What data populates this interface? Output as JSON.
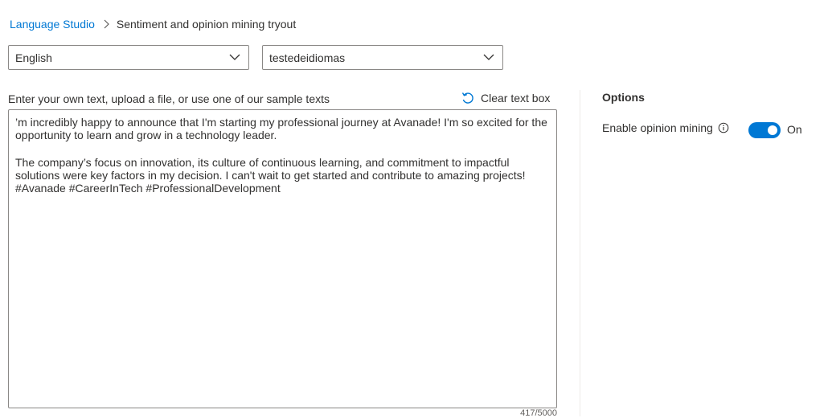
{
  "breadcrumb": {
    "root": "Language Studio",
    "current": "Sentiment and opinion mining tryout"
  },
  "selectors": {
    "language": "English",
    "project": "testedeidiomas"
  },
  "input": {
    "instructions": "Enter your own text, upload a file, or use one of our sample texts",
    "clear_label": "Clear text box",
    "paragraph_1": "’m incredibly happy to announce that I'm starting my professional journey at Avanade! I'm so excited for the opportunity to learn and grow in a technology leader.",
    "paragraph_2": "The company’s focus on innovation, its culture of continuous learning, and commitment to impactful solutions were key factors in my decision. I can't wait to get started and contribute to amazing projects!\n#Avanade #CareerInTech #ProfessionalDevelopment",
    "char_count": "417/5000"
  },
  "options": {
    "title": "Options",
    "opinion_mining_label": "Enable opinion mining",
    "opinion_mining_state": "On"
  },
  "icons": {
    "breadcrumb_separator": "chevron-right-icon",
    "dropdown": "chevron-down-icon",
    "clear": "undo-icon",
    "info": "info-icon"
  },
  "colors": {
    "accent": "#0078d4",
    "text": "#323130",
    "border": "#8a8886"
  }
}
